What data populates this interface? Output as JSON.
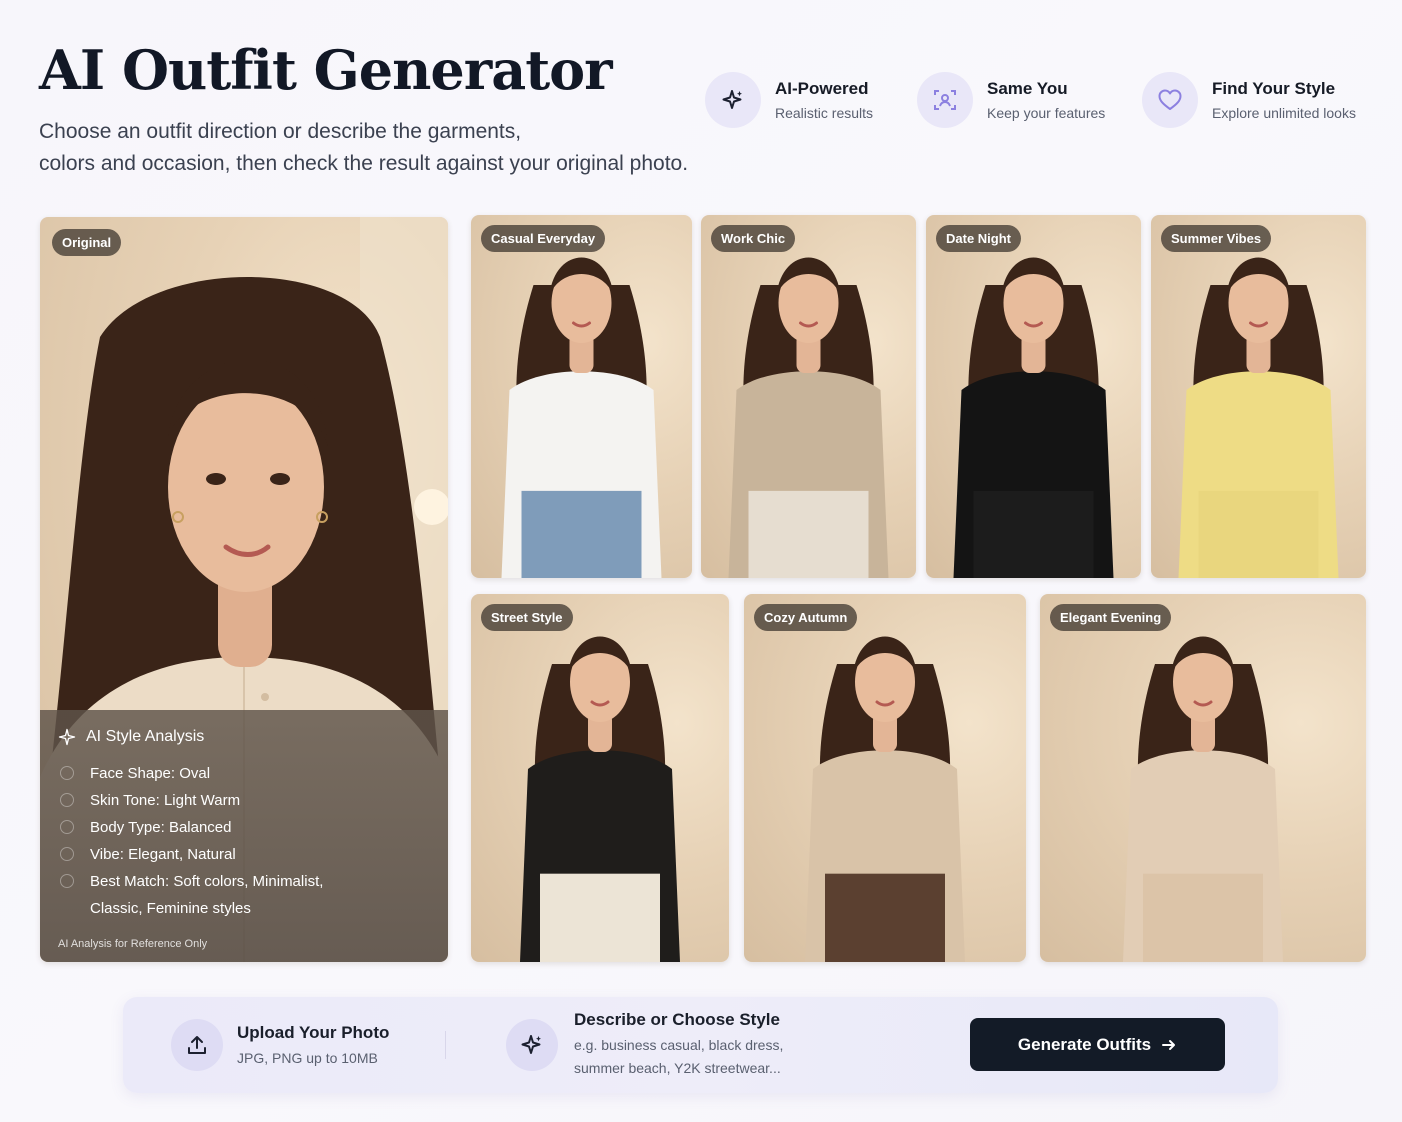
{
  "header": {
    "title": "AI Outfit Generator",
    "subtitle_line1": "Choose an outfit direction or describe the garments,",
    "subtitle_line2": "colors and occasion, then check the result against your original photo."
  },
  "features": [
    {
      "icon": "sparkle-icon",
      "title": "AI-Powered",
      "subtitle": "Realistic results"
    },
    {
      "icon": "face-scan-icon",
      "title": "Same You",
      "subtitle": "Keep your features"
    },
    {
      "icon": "heart-icon",
      "title": "Find Your Style",
      "subtitle": "Explore unlimited looks"
    }
  ],
  "original": {
    "label": "Original",
    "analysis": {
      "heading": "AI Style Analysis",
      "rows": [
        "Face Shape: Oval",
        "Skin Tone: Light Warm",
        "Body Type: Balanced",
        "Vibe: Elegant, Natural",
        "Best Match: Soft colors, Minimalist,",
        "Classic, Feminine styles"
      ],
      "note": "AI Analysis for Reference Only"
    }
  },
  "outfits": [
    {
      "label": "Casual Everyday",
      "top": "#f4f3f1",
      "bottom": "#7f9cba"
    },
    {
      "label": "Work Chic",
      "top": "#c8b49a",
      "bottom": "#e6ddd0"
    },
    {
      "label": "Date Night",
      "top": "#141414",
      "bottom": "#1c1c1c"
    },
    {
      "label": "Summer Vibes",
      "top": "#eedc85",
      "bottom": "#e9d67e"
    },
    {
      "label": "Street Style",
      "top": "#1f1d1b",
      "bottom": "#ece4d6"
    },
    {
      "label": "Cozy Autumn",
      "top": "#d9c3a8",
      "bottom": "#5b4030"
    },
    {
      "label": "Elegant Evening",
      "top": "#e2cdb5",
      "bottom": "#dcc4a8"
    }
  ],
  "action_bar": {
    "upload_title": "Upload Your Photo",
    "upload_sub": "JPG, PNG up to 10MB",
    "style_title": "Describe or Choose Style",
    "style_sub_line1": "e.g. business casual, black dress,",
    "style_sub_line2": "summer beach, Y2K streetwear...",
    "button_label": "Generate Outfits"
  },
  "colors": {
    "accent": "#7d6bd8",
    "button_bg": "#131b27",
    "hair": "#3a2418",
    "skin": "#e3b596"
  }
}
